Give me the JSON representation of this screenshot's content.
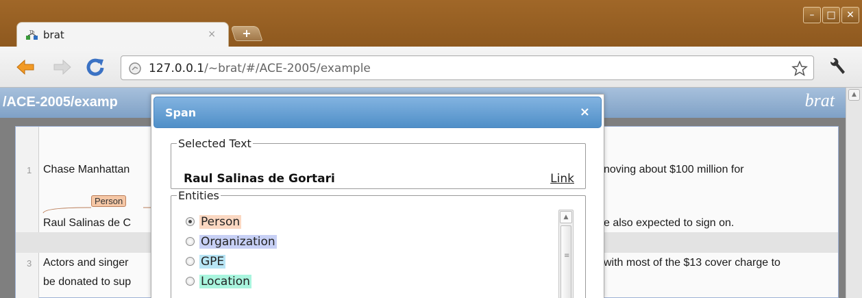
{
  "window": {
    "controls": {
      "minimize": "–",
      "maximize": "□",
      "close": "✕"
    }
  },
  "tab": {
    "title": "brat",
    "close": "×",
    "new_tab": "+"
  },
  "address_bar": {
    "url_host": "127.0.0.1",
    "url_path": "/~brat/#/ACE-2005/example"
  },
  "page": {
    "doc_path": "/ACE-2005/examp",
    "logo": "brat",
    "lines": [
      {
        "number": "1",
        "text": "Chase Manhattan",
        "tail": "noving about $100 million for"
      },
      {
        "text": "Raul Salinas de C",
        "tail": "e also expected to sign on."
      },
      {
        "number": "3",
        "text": "Actors and singer",
        "tail": "with most of the $13 cover charge to"
      },
      {
        "text": "be donated to sup"
      }
    ],
    "annotation_label": "Person"
  },
  "dialog": {
    "title": "Span",
    "close": "×",
    "selected_text": {
      "legend": "Selected Text",
      "value": "Raul Salinas de Gortari",
      "link": "Link"
    },
    "entities": {
      "legend": "Entities",
      "items": [
        {
          "label": "Person",
          "color": "#fbd8c2",
          "checked": true
        },
        {
          "label": "Organization",
          "color": "#c7d0f5",
          "checked": false
        },
        {
          "label": "GPE",
          "color": "#b8e5f5",
          "checked": false
        },
        {
          "label": "Location",
          "color": "#a9f5de",
          "checked": false
        }
      ]
    }
  },
  "colors": {
    "titlebar": "#9a6224",
    "dialog_header": "#5b98cf",
    "page_header": "#8fabcf",
    "person_label": "#f5c7a6"
  }
}
